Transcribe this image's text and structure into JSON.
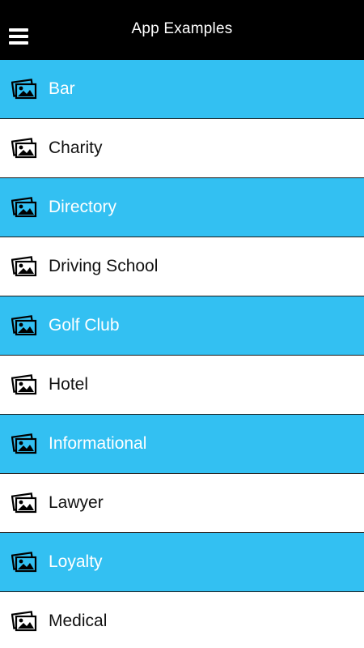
{
  "header": {
    "title": "App Examples",
    "menu_icon": "hamburger-menu-icon"
  },
  "colors": {
    "header_bg": "#000000",
    "accent_row": "#33c0f2",
    "plain_row": "#ffffff"
  },
  "items": [
    {
      "label": "Bar",
      "icon": "images-icon",
      "style": "blue"
    },
    {
      "label": "Charity",
      "icon": "images-icon",
      "style": "white"
    },
    {
      "label": "Directory",
      "icon": "images-icon",
      "style": "blue"
    },
    {
      "label": "Driving School",
      "icon": "images-icon",
      "style": "white"
    },
    {
      "label": "Golf Club",
      "icon": "images-icon",
      "style": "blue"
    },
    {
      "label": "Hotel",
      "icon": "images-icon",
      "style": "white"
    },
    {
      "label": "Informational",
      "icon": "images-icon",
      "style": "blue"
    },
    {
      "label": "Lawyer",
      "icon": "images-icon",
      "style": "white"
    },
    {
      "label": "Loyalty",
      "icon": "images-icon",
      "style": "blue"
    },
    {
      "label": "Medical",
      "icon": "images-icon",
      "style": "white"
    }
  ]
}
